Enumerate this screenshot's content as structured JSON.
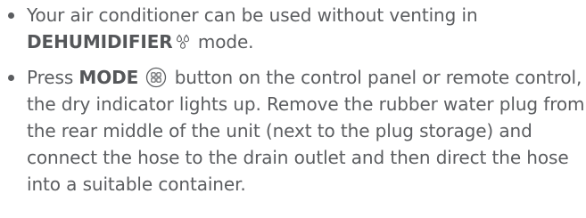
{
  "bullets": [
    {
      "line1": "Your air conditioner can be used without venting in",
      "mode_name": "DEHUMIDIFIER",
      "icon": "water-drops-icon",
      "after": " mode."
    },
    {
      "press": "Press ",
      "keyword": "MODE",
      "icon": "mode-button-icon",
      "rest": " button on the control panel or remote control, the dry indicator lights up. Remove the rubber water plug from the rear middle of the unit (next to the plug storage) and connect the hose to the drain outlet and then direct the hose into a suitable container."
    }
  ],
  "colors": {
    "text": "#5b5d60"
  }
}
